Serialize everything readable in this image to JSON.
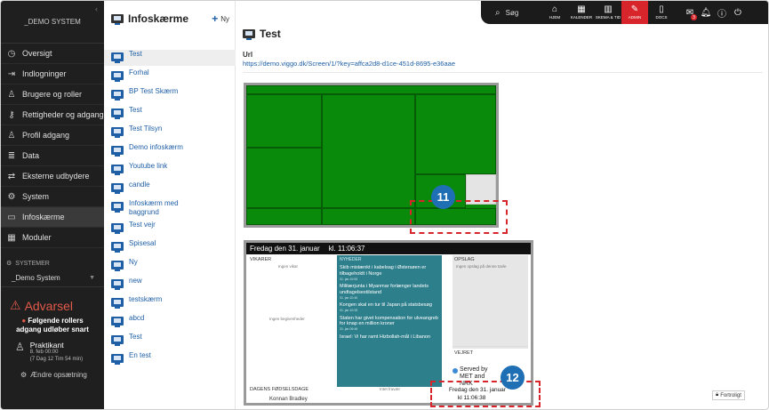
{
  "sidebar": {
    "brand": "_DEMO SYSTEM",
    "items": [
      {
        "label": "Oversigt",
        "icon": "dashboard-icon"
      },
      {
        "label": "Indlogninger",
        "icon": "login-icon"
      },
      {
        "label": "Brugere og roller",
        "icon": "users-icon"
      },
      {
        "label": "Rettigheder og adgang",
        "icon": "key-icon"
      },
      {
        "label": "Profil adgang",
        "icon": "profile-icon"
      },
      {
        "label": "Data",
        "icon": "database-icon"
      },
      {
        "label": "Eksterne udbydere",
        "icon": "external-icon"
      },
      {
        "label": "System",
        "icon": "gear-icon"
      },
      {
        "label": "Infoskærme",
        "icon": "monitor-icon"
      },
      {
        "label": "Moduler",
        "icon": "modules-icon"
      }
    ],
    "systems_heading": "SYSTEMER",
    "system_selected": "_Demo System",
    "warning_title": "Advarsel",
    "warning_text": "Følgende rollers adgang udløber snart",
    "practicant_name": "Praktikant",
    "practicant_date": "8. feb 00:00",
    "practicant_remaining": "(7 Dag 12 Tim 54 min)",
    "change_label": "Ændre opsætning"
  },
  "list": {
    "title": "Infoskærme",
    "add_label": "Ny",
    "items": [
      "Test",
      "Forhal",
      "BP Test Skærm",
      "Test",
      "Test Tilsyn",
      "Demo infoskærm",
      "Youtube link",
      "candle",
      "Infoskærm med baggrund",
      "Test vejr",
      "Spisesal",
      "Ny",
      "new",
      "testskærm",
      "abcd",
      "Test",
      "En test"
    ]
  },
  "topbar": {
    "search_label": "Søg",
    "buttons": [
      {
        "label": "HJEM",
        "icon": "home-icon"
      },
      {
        "label": "KALENDER",
        "icon": "calendar-icon"
      },
      {
        "label": "SKEMA & TID",
        "icon": "schedule-icon"
      },
      {
        "label": "ADMIN",
        "icon": "wrench-icon"
      },
      {
        "label": "DOCS",
        "icon": "docs-icon"
      }
    ],
    "mail_badge": "3"
  },
  "main": {
    "title": "Test",
    "url_label": "Url",
    "url_value": "https://demo.viggo.dk/Screen/1/?key=affca2d8-d1ce-451d-8695-e36aae"
  },
  "preview2": {
    "header_date": "Fredag den 31. januar",
    "header_time": "kl. 11:06:37",
    "vikarer_label": "VIKARER",
    "vikarer_empty": "Ingen vikar",
    "begivenheder_empty": "Ingen begivenheder",
    "nyheder_label": "NYHEDER",
    "news": [
      {
        "title": "Skib mistænkt i kabelsag i Østersøen er tilbageholdt i Norge",
        "date": "31. jan 10:53"
      },
      {
        "title": "Militærjunta i Myanmar forlænger landets undtagelsestilstand",
        "date": "31. jan 10:40"
      },
      {
        "title": "Kongen skal en tur til Japan på statsbesøg",
        "date": "31. jan 10:25"
      },
      {
        "title": "Staten har givet kompensation for ulveangreb for knap en million kroner",
        "date": "31. jan 09:46"
      },
      {
        "title": "Israel: Vi har ramt Hizbollah-mål i Libanon",
        "date": ""
      }
    ],
    "opslag_label": "OPSLAG",
    "opslag_empty": "Ingen opslag på denne tavle",
    "vejret_label": "VEJRET",
    "served_text": "Served by MET and NRK",
    "footer_date": "Fredag den 31. januar",
    "footer_time": "kl 11:06:38",
    "foedselsdage_label": "DAGENS FØDSELSDAGE",
    "birthday_name": "Konnan Bradley",
    "next_lesson": "Intet fravær"
  },
  "fortrolig_label": "Fortroligt",
  "callouts": [
    "11",
    "12"
  ]
}
